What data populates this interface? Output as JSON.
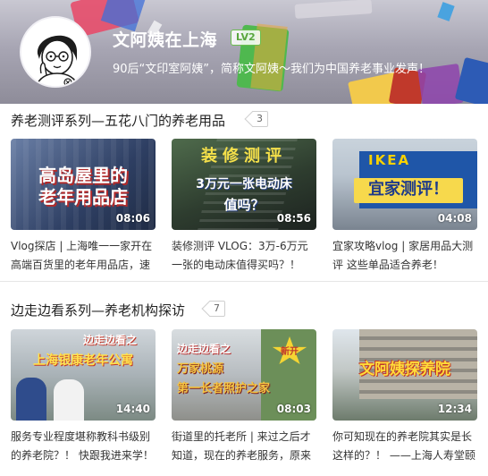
{
  "profile": {
    "name": "文阿姨在上海",
    "level": "LV2",
    "bio": "90后“文印室阿姨”，简称文阿姨～我们为中国养老事业发声！"
  },
  "sections": [
    {
      "title": "养老测评系列—五花八门的养老用品",
      "count": "3",
      "videos": [
        {
          "thumb_text": [
            "高岛屋里的",
            "老年用品店"
          ],
          "duration": "08:06",
          "title": "Vlog探店 | 上海唯一一家开在高端百货里的老年用品店，速"
        },
        {
          "thumb_text": [
            "装修测评",
            "3万元一张电动床",
            "值吗？"
          ],
          "duration": "08:56",
          "title": "装修测评 VLOG：3万-6万元一张的电动床值得买吗？！"
        },
        {
          "thumb_text": [
            "IKEA",
            "宜家测评！"
          ],
          "duration": "04:08",
          "title": "宜家攻略vlog | 家居用品大测评 这些单品适合养老！"
        }
      ]
    },
    {
      "title": "边走边看系列—养老机构探访",
      "count": "7",
      "videos": [
        {
          "thumb_text": [
            "边走边看之",
            "上海银康老年公寓"
          ],
          "duration": "14:40",
          "title": "服务专业程度堪称教科书级别的养老院？！ 快跟我进来学！"
        },
        {
          "thumb_text": [
            "边走边看之",
            "万家桃源",
            "第一长者照护之家",
            "新开"
          ],
          "duration": "08:03",
          "title": "街道里的托老所 | 来过之后才知道，现在的养老服务，原来"
        },
        {
          "thumb_text": [
            "文阿姨探养院"
          ],
          "duration": "12:34",
          "title": "你可知现在的养老院其实是长这样的？！ ——上海人寿堂颐"
        }
      ]
    }
  ]
}
